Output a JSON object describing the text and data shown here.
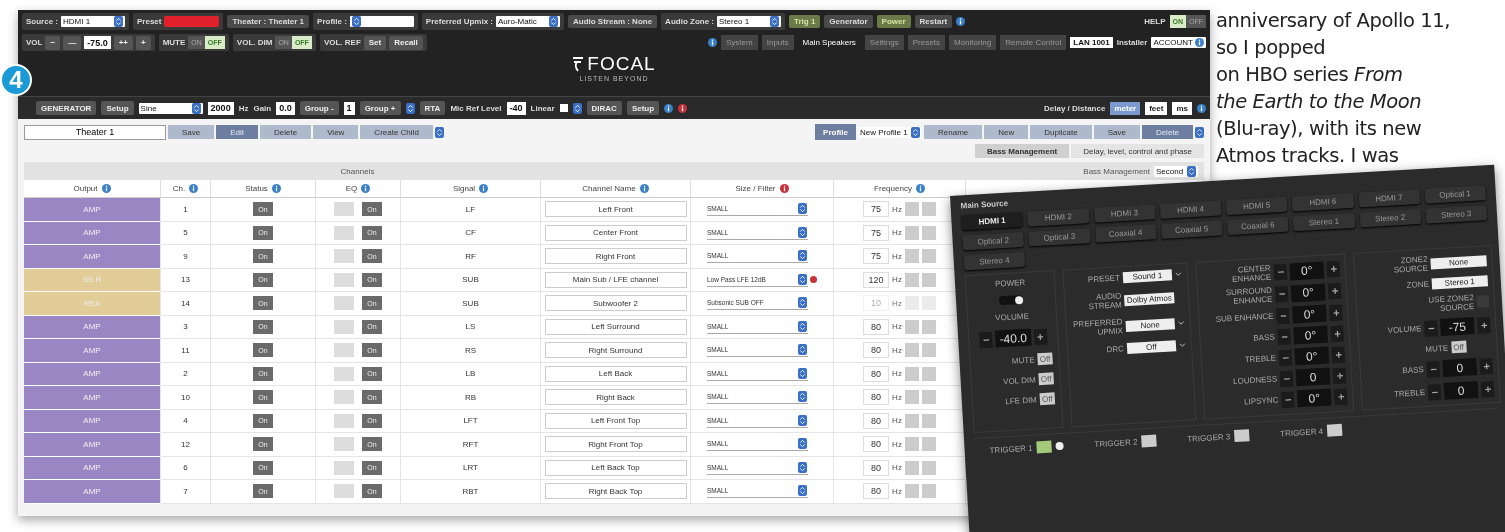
{
  "badge": "4",
  "top_bar": {
    "row1": [
      {
        "kind": "select",
        "label": "Source :",
        "value": "HDMI 1"
      },
      {
        "kind": "swatch",
        "label": "Preset",
        "color": "#e0202a"
      },
      {
        "kind": "chip",
        "text": "Theater : Theater 1"
      },
      {
        "kind": "select",
        "label": "Profile :"
      },
      {
        "kind": "select",
        "label": "Preferred Upmix :",
        "value": "Auro-Matic"
      },
      {
        "kind": "chip",
        "text": "Audio Stream : None"
      },
      {
        "kind": "select",
        "label": "Audio Zone :",
        "value": "Stereo 1"
      },
      {
        "kind": "chip",
        "text": "Trig 1",
        "active": true
      },
      {
        "kind": "chip",
        "text": "Generator",
        "active": false
      },
      {
        "kind": "chip",
        "text": "Power",
        "active": true
      },
      {
        "kind": "chip",
        "text": "Restart",
        "active": false
      },
      {
        "kind": "info"
      }
    ],
    "help": {
      "label": "HELP",
      "options": [
        {
          "label": "ON",
          "selected": true
        },
        {
          "label": "OFF",
          "selected": false
        }
      ]
    },
    "volume": {
      "label": "VOL",
      "buttons": [
        "−",
        "—"
      ],
      "value": "-75.0",
      "buttons_after": [
        "++",
        "+"
      ]
    },
    "toggles": [
      {
        "label": "MUTE",
        "options": [
          {
            "label": "ON",
            "selected": false
          },
          {
            "label": "OFF",
            "selected": true
          }
        ]
      },
      {
        "label": "VOL. DIM",
        "options": [
          {
            "label": "ON",
            "selected": false
          },
          {
            "label": "OFF",
            "selected": true
          }
        ]
      }
    ],
    "vol_ref": {
      "label": "VOL. REF",
      "buttons": [
        "Set",
        "Recall"
      ]
    },
    "nav": [
      {
        "label": "System",
        "selected": false
      },
      {
        "label": "Inputs",
        "selected": false
      },
      {
        "label": "Main Speakers",
        "selected": true
      },
      {
        "label": "Settings",
        "selected": false
      },
      {
        "label": "Presets",
        "selected": false
      },
      {
        "label": "Monitoring",
        "selected": false
      },
      {
        "label": "Remote Control",
        "selected": false
      }
    ],
    "lan": "LAN 1001",
    "installer": "Installer",
    "account": "ACCOUNT",
    "logo": {
      "name": "FOCAL",
      "tagline": "LISTEN BEYOND"
    }
  },
  "tool_bar": {
    "generator": "GENERATOR",
    "setup": "Setup",
    "signal": "Sine",
    "freq": "2000",
    "freq_unit": "Hz",
    "gain_label": "Gain",
    "gain": "0.0",
    "group_minus": "Group -",
    "group": "1",
    "group_plus": "Group +",
    "rta": "RTA",
    "mic_label": "Mic Ref Level",
    "mic": "-40",
    "linear": "Linear",
    "linear_checked": false,
    "dirac": "DIRAC",
    "dirac_setup": "Setup",
    "delay_label": "Delay / Distance",
    "units": [
      {
        "label": "meter",
        "selected": true
      },
      {
        "label": "feet",
        "selected": false
      },
      {
        "label": "ms",
        "selected": false
      }
    ]
  },
  "theater_bar": {
    "name": "Theater 1",
    "buttons": [
      {
        "label": "Save",
        "disabled": false
      },
      {
        "label": "Edit",
        "disabled": true
      },
      {
        "label": "Delete",
        "disabled": false
      },
      {
        "label": "View",
        "disabled": false
      },
      {
        "label": "Create Child",
        "disabled": false
      }
    ],
    "profile_label": "Profile",
    "profile": "New Profile 1",
    "profile_buttons": [
      {
        "label": "Rename",
        "disabled": false
      },
      {
        "label": "New",
        "disabled": false
      },
      {
        "label": "Duplicate",
        "disabled": false
      },
      {
        "label": "Save",
        "disabled": false
      },
      {
        "label": "Delete",
        "disabled": true
      }
    ]
  },
  "tabs": [
    {
      "label": "Bass Management",
      "selected": true
    },
    {
      "label": "Delay, level, control and phase",
      "selected": false
    }
  ],
  "table": {
    "group_left": "Channels",
    "group_right": "Bass Management",
    "bass_mode": "Second",
    "columns": [
      {
        "label": "Output"
      },
      {
        "label": "Ch."
      },
      {
        "label": "Status"
      },
      {
        "label": "EQ"
      },
      {
        "label": "Signal"
      },
      {
        "label": "Channel Name"
      },
      {
        "label": "Size / Filter"
      },
      {
        "label": "Frequency"
      }
    ],
    "rows": [
      {
        "output": "AMP",
        "color": "#9b86c4",
        "ch": "1",
        "status": "On",
        "eq_checked": false,
        "eq": "On",
        "signal": "LF",
        "name": "Left Front",
        "size": "SMALL",
        "freq": "75",
        "unit": "Hz",
        "disabled": false,
        "warning": false
      },
      {
        "output": "AMP",
        "color": "#9b86c4",
        "ch": "5",
        "status": "On",
        "eq_checked": false,
        "eq": "On",
        "signal": "CF",
        "name": "Center Front",
        "size": "SMALL",
        "freq": "75",
        "unit": "Hz",
        "disabled": false,
        "warning": false
      },
      {
        "output": "AMP",
        "color": "#9b86c4",
        "ch": "9",
        "status": "On",
        "eq_checked": false,
        "eq": "On",
        "signal": "RF",
        "name": "Right Front",
        "size": "SMALL",
        "freq": "75",
        "unit": "Hz",
        "disabled": false,
        "warning": false
      },
      {
        "output": "SS R",
        "color": "#e2cc98",
        "ch": "13",
        "status": "On",
        "eq_checked": false,
        "eq": "On",
        "signal": "SUB",
        "name": "Main Sub / LFE channel",
        "size": "Low Pass LFE 12dB",
        "freq": "120",
        "unit": "Hz",
        "disabled": false,
        "warning": true
      },
      {
        "output": "REA",
        "color": "#e2cc98",
        "ch": "14",
        "status": "On",
        "eq_checked": false,
        "eq": "On",
        "signal": "SUB",
        "name": "Subwoofer 2",
        "size": "Subsonic SUB OFF",
        "freq": "10",
        "unit": "Hz",
        "disabled": true,
        "warning": false
      },
      {
        "output": "AMP",
        "color": "#9b86c4",
        "ch": "3",
        "status": "On",
        "eq_checked": false,
        "eq": "On",
        "signal": "LS",
        "name": "Left Surround",
        "size": "SMALL",
        "freq": "80",
        "unit": "Hz",
        "disabled": false,
        "warning": false
      },
      {
        "output": "AMP",
        "color": "#9b86c4",
        "ch": "11",
        "status": "On",
        "eq_checked": false,
        "eq": "On",
        "signal": "RS",
        "name": "Right Surround",
        "size": "SMALL",
        "freq": "80",
        "unit": "Hz",
        "disabled": false,
        "warning": false
      },
      {
        "output": "AMP",
        "color": "#9b86c4",
        "ch": "2",
        "status": "On",
        "eq_checked": false,
        "eq": "On",
        "signal": "LB",
        "name": "Left Back",
        "size": "SMALL",
        "freq": "80",
        "unit": "Hz",
        "disabled": false,
        "warning": false
      },
      {
        "output": "AMP",
        "color": "#9b86c4",
        "ch": "10",
        "status": "On",
        "eq_checked": false,
        "eq": "On",
        "signal": "RB",
        "name": "Right Back",
        "size": "SMALL",
        "freq": "80",
        "unit": "Hz",
        "disabled": false,
        "warning": false
      },
      {
        "output": "AMP",
        "color": "#9b86c4",
        "ch": "4",
        "status": "On",
        "eq_checked": false,
        "eq": "On",
        "signal": "LFT",
        "name": "Left Front Top",
        "size": "SMALL",
        "freq": "80",
        "unit": "Hz",
        "disabled": false,
        "warning": false
      },
      {
        "output": "AMP",
        "color": "#9b86c4",
        "ch": "12",
        "status": "On",
        "eq_checked": false,
        "eq": "On",
        "signal": "RFT",
        "name": "Right Front Top",
        "size": "SMALL",
        "freq": "80",
        "unit": "Hz",
        "disabled": false,
        "warning": false
      },
      {
        "output": "AMP",
        "color": "#9b86c4",
        "ch": "6",
        "status": "On",
        "eq_checked": false,
        "eq": "On",
        "signal": "LRT",
        "name": "Left Back Top",
        "size": "SMALL",
        "freq": "80",
        "unit": "Hz",
        "disabled": false,
        "warning": false
      },
      {
        "output": "AMP",
        "color": "#9b86c4",
        "ch": "7",
        "status": "On",
        "eq_checked": false,
        "eq": "On",
        "signal": "RBT",
        "name": "Right Back Top",
        "size": "SMALL",
        "freq": "80",
        "unit": "Hz",
        "disabled": false,
        "warning": false
      }
    ]
  },
  "article": {
    "lines": [
      "anniversary of Apollo 11,",
      "so I popped",
      "on HBO series *From*",
      "*the Earth to the Moon*",
      "(Blu-ray), with its new",
      "Atmos tracks. I was"
    ]
  },
  "zone_panel": {
    "title": "Main Source",
    "sources": [
      {
        "label": "HDMI 1",
        "selected": true
      },
      {
        "label": "HDMI 2",
        "selected": false
      },
      {
        "label": "HDMI 3",
        "selected": false
      },
      {
        "label": "HDMI 4",
        "selected": false
      },
      {
        "label": "HDMI 5",
        "selected": false
      },
      {
        "label": "HDMI 6",
        "selected": false
      },
      {
        "label": "HDMI 7",
        "selected": false
      },
      {
        "label": "Optical 1",
        "selected": false
      },
      {
        "label": "Optical 2",
        "selected": false
      },
      {
        "label": "Optical 3",
        "selected": false
      },
      {
        "label": "Coaxial 4",
        "selected": false
      },
      {
        "label": "Coaxial 5",
        "selected": false
      },
      {
        "label": "Coaxial 6",
        "selected": false
      },
      {
        "label": "Stereo 1",
        "selected": false
      },
      {
        "label": "Stereo 2",
        "selected": false
      },
      {
        "label": "Stereo 3",
        "selected": false
      },
      {
        "label": "Stereo 4",
        "selected": false
      }
    ],
    "power": {
      "label": "POWER",
      "on": true
    },
    "volume": {
      "label": "VOLUME",
      "value": "-40.0"
    },
    "toggles": [
      {
        "label": "MUTE",
        "value": "Off"
      },
      {
        "label": "VOL DIM",
        "value": "Off"
      },
      {
        "label": "LFE DIM",
        "value": "Off"
      }
    ],
    "settings": [
      {
        "kind": "select",
        "label": "PRESET",
        "value": "Sound 1"
      },
      {
        "kind": "field",
        "label": "AUDIO STREAM",
        "value": "Dolby Atmos"
      },
      {
        "kind": "select",
        "label": "PREFERRED UPMIX",
        "value": "None"
      },
      {
        "kind": "select",
        "label": "DRC",
        "value": "Off"
      }
    ],
    "adjust": [
      {
        "label": "CENTER ENHANCE",
        "value": "0°"
      },
      {
        "label": "SURROUND ENHANCE",
        "value": "0°"
      },
      {
        "label": "SUB ENHANCE",
        "value": "0°"
      },
      {
        "label": "BASS",
        "value": "0°"
      },
      {
        "label": "TREBLE",
        "value": "0°"
      },
      {
        "label": "LOUDNESS",
        "value": "0"
      },
      {
        "label": "LIPSYNC",
        "value": "0°"
      }
    ],
    "zone2": {
      "source_label": "ZONE2 SOURCE",
      "source": "None",
      "zone_label": "ZONE",
      "zone": "Stereo 1",
      "use_label": "USE ZONE2 SOURCE",
      "use_checked": false,
      "adjust": [
        {
          "label": "VOLUME",
          "value": "-75"
        },
        {
          "label": "BASS",
          "value": "0"
        },
        {
          "label": "TREBLE",
          "value": "0"
        }
      ],
      "mute_label": "MUTE",
      "mute": "Off"
    },
    "triggers": [
      {
        "label": "TRIGGER 1",
        "on": true
      },
      {
        "label": "TRIGGER 2",
        "on": false
      },
      {
        "label": "TRIGGER 3",
        "on": false
      },
      {
        "label": "TRIGGER 4",
        "on": false
      }
    ]
  }
}
